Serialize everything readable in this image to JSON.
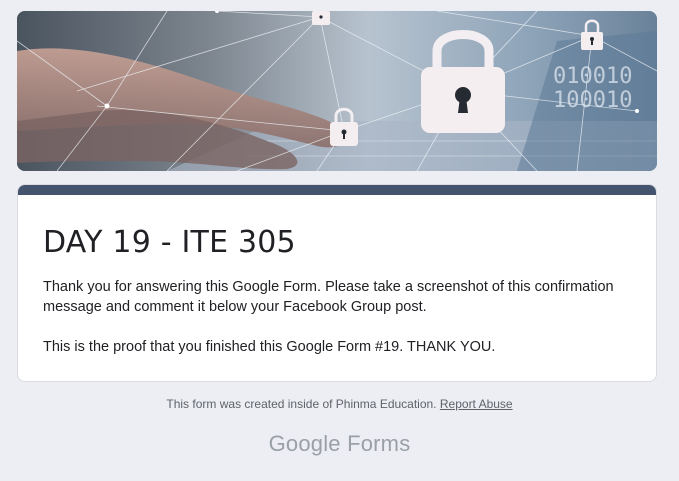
{
  "header_image": {
    "icon": "padlock-network-image",
    "binary_text": [
      "010010",
      "100010"
    ]
  },
  "card": {
    "accent_color": "#44546f",
    "title": "DAY 19 - ITE 305",
    "message_line1": "Thank you for answering this Google Form. Please take a screenshot of this confirmation message and comment it below your Facebook Group post.",
    "message_line2": "This is the proof that you finished this Google Form #19. THANK YOU."
  },
  "footer": {
    "created_text": "This form was created inside of Phinma Education.",
    "report_link": "Report Abuse"
  },
  "brand": {
    "google": "Google",
    "forms": "Forms"
  }
}
